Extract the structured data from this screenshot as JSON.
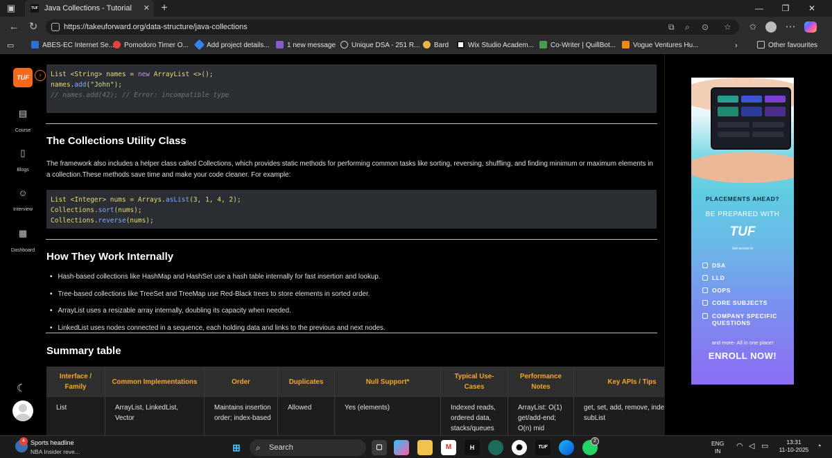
{
  "browser": {
    "tab_title": "Java Collections - Tutorial",
    "url": "https://takeuforward.org/data-structure/java-collections",
    "bookmarks": [
      {
        "label": "ABES-EC Internet Se...",
        "color": "#2f6fd6"
      },
      {
        "label": "Pomodoro Timer O...",
        "color": "#e8413a"
      },
      {
        "label": "Add project details...",
        "color": "#3d7ff5"
      },
      {
        "label": "1 new message",
        "color": "#8a5cc9"
      },
      {
        "label": "Unique DSA - 251 R...",
        "color": "#8a8a8a"
      },
      {
        "label": "Bard",
        "color": "#e9b44c"
      },
      {
        "label": "Wix Studio Academ...",
        "color": "#111111"
      },
      {
        "label": "Co-Writer | QuillBot...",
        "color": "#4c9a4c"
      },
      {
        "label": "Vogue Ventures Hu...",
        "color": "#f28a1b"
      }
    ],
    "other_favourites": "Other favourites"
  },
  "sidebar": {
    "logo": "TUF",
    "items": [
      {
        "label": "Course",
        "icon": "book-icon"
      },
      {
        "label": "Blogs",
        "icon": "blog-icon"
      },
      {
        "label": "Interview",
        "icon": "interview-icon"
      },
      {
        "label": "Dashboard",
        "icon": "dashboard-icon"
      }
    ]
  },
  "article": {
    "code1": {
      "l1_a": "List <String> names = ",
      "l1_kw": "new",
      "l1_b": " ArrayList <>();",
      "l2_a": "names.",
      "l2_fn": "add",
      "l2_b": "(",
      "l2_str": "\"John\"",
      "l2_c": ");",
      "l3": "// names.add(42); // Error: incompatible type"
    },
    "h_collections": "The Collections Utility Class",
    "p_collections": "The framework also includes a helper class called Collections, which provides static methods for performing common tasks like sorting, reversing, shuffling, and finding minimum or maximum elements in a collection.These methods save time and make your code cleaner. For example:",
    "code2": {
      "l1_a": "List <Integer> nums = Arrays.",
      "l1_fn": "asList",
      "l1_b": "(3, 1, 4, 2);",
      "l2_a": "Collections.",
      "l2_fn": "sort",
      "l2_b": "(nums);",
      "l3_a": "Collections.",
      "l3_fn": "reverse",
      "l3_b": "(nums);"
    },
    "h_internal": "How They Work Internally",
    "bullets": [
      "Hash-based collections like HashMap and HashSet use a hash table internally for fast insertion and lookup.",
      "Tree-based collections like TreeSet and TreeMap use Red-Black trees to store elements in sorted order.",
      "ArrayList uses a resizable array internally, doubling its capacity when needed.",
      "LinkedList uses nodes connected in a sequence, each holding data and links to the previous and next nodes."
    ],
    "h_summary": "Summary table",
    "table": {
      "headers": [
        "Interface / Family",
        "Common Implementations",
        "Order",
        "Duplicates",
        "Null Support*",
        "Typical Use-Cases",
        "Performance Notes",
        "Key APIs / Tips"
      ],
      "rows": [
        [
          "List",
          "ArrayList, LinkedList, Vector",
          "Maintains insertion order; index-based",
          "Allowed",
          "Yes (elements)",
          "Indexed reads, ordered data, stacks/queues",
          "ArrayList: O(1) get/add-end; O(n) mid",
          "get, set, add, remove, indexOf, subList"
        ]
      ]
    }
  },
  "ad": {
    "headline": "PLACEMENTS AHEAD?",
    "subhead": "BE PREPARED WITH",
    "brand": "TUF",
    "tagline": "Get access to",
    "items": [
      "DSA",
      "LLD",
      "OOPS",
      "CORE SUBJECTS",
      "COMPANY SPECIFIC QUESTIONS"
    ],
    "more": "and more- All in one place!",
    "cta": "ENROLL NOW!"
  },
  "taskbar": {
    "news_title": "Sports headline",
    "news_sub": "NBA Insider reve...",
    "news_badge": "4",
    "search": "Search",
    "whatsapp_badge": "2",
    "lang": "ENG",
    "region": "IN",
    "time": "13:31",
    "date": "11-10-2025"
  }
}
